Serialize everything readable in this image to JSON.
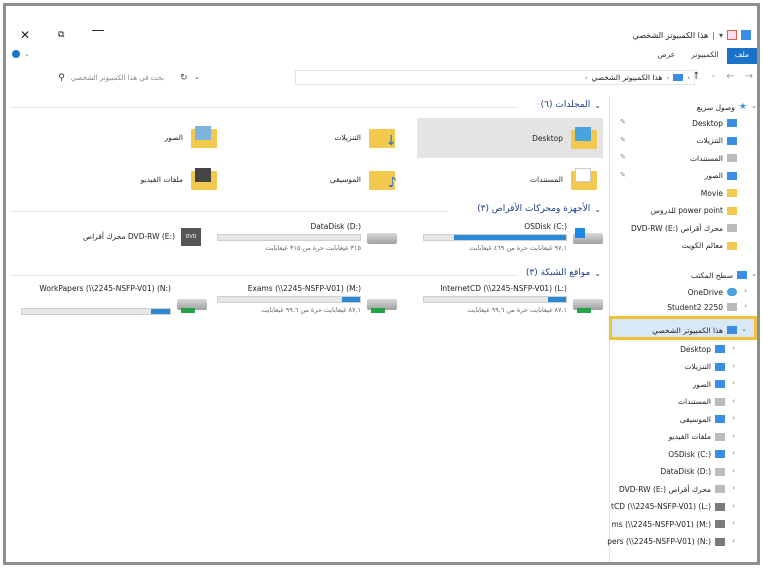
{
  "window": {
    "title": "هذا الكمبيوتر الشخصي",
    "close_glyph": "✕",
    "max_glyph": "⧉"
  },
  "ribbon": {
    "tabs": [
      "ملف",
      "الكمبيوتر",
      "عرض"
    ]
  },
  "address": {
    "path": [
      "هذا الكمبيوتر الشخصي"
    ],
    "search_placeholder": "بحث في هذا الكمبيوتر الشخصي"
  },
  "groups": {
    "folders": "المجلدات (٦)",
    "devices": "الأجهزة ومحركات الأقراص (٣)",
    "network": "مواقع الشبكة (٣)"
  },
  "folders": [
    {
      "label": "Desktop",
      "icon": "desktop-folder-icon"
    },
    {
      "label": "التنزيلات",
      "icon": "downloads-folder-icon"
    },
    {
      "label": "الصور",
      "icon": "pictures-folder-icon"
    },
    {
      "label": "المستندات",
      "icon": "documents-folder-icon"
    },
    {
      "label": "الموسيقى",
      "icon": "music-folder-icon"
    },
    {
      "label": "ملفات الفيديو",
      "icon": "videos-folder-icon"
    }
  ],
  "drives": [
    {
      "name": "OSDisk (C:)",
      "free": "٩٧,١ غيغابايت حرة من ٤٦٩ غيغابايت",
      "fill": 0.79
    },
    {
      "name": "DataDisk (D:)",
      "free": "٣١٥ غيغابايت حرة من ٣١٥ غيغابايت",
      "fill": 0.0
    },
    {
      "name": "محرك أقراص DVD-RW (E:)",
      "free": "",
      "fill": null
    }
  ],
  "network": [
    {
      "name": "InternetCD (\\\\2245-NSFP-V01) (L:)",
      "free": "٨٧,١ غيغابايت حرة من ٩٩,٦ غيغابايت",
      "fill": 0.13
    },
    {
      "name": "Exams (\\\\2245-NSFP-V01) (M:)",
      "free": "٨٧,١ غيغابايت حرة من ٩٩,٦ غيغابايت",
      "fill": 0.13
    },
    {
      "name": "WorkPapers (\\\\2245-NSFP-V01) (N:)",
      "free": "",
      "fill": 0.13
    }
  ],
  "nav": {
    "quick_access": "وصول سريع",
    "quick_items": [
      "Desktop",
      "التنزيلات",
      "المستندات",
      "الصور",
      "Movie",
      "power point للدروس",
      "محرك أقراص DVD-RW (E:)",
      "معالم الكويت"
    ],
    "desktop_root": "سطح المكتب",
    "onedrive": "OneDrive",
    "student": "Student2 2250",
    "this_pc": "هذا الكمبيوتر الشخصي",
    "pc_items": [
      "Desktop",
      "التنزيلات",
      "الصور",
      "المستندات",
      "الموسيقى",
      "ملفات الفيديو",
      "OSDisk (C:)",
      "DataDisk (D:)",
      "محرك أقراص DVD-RW (E:)",
      "tCD (\\\\2245-NSFP-V01) (L:)",
      "ms (\\\\2245-NSFP-V01) (M:)",
      "pers (\\\\2245-NSFP-V01) (N:)"
    ]
  }
}
